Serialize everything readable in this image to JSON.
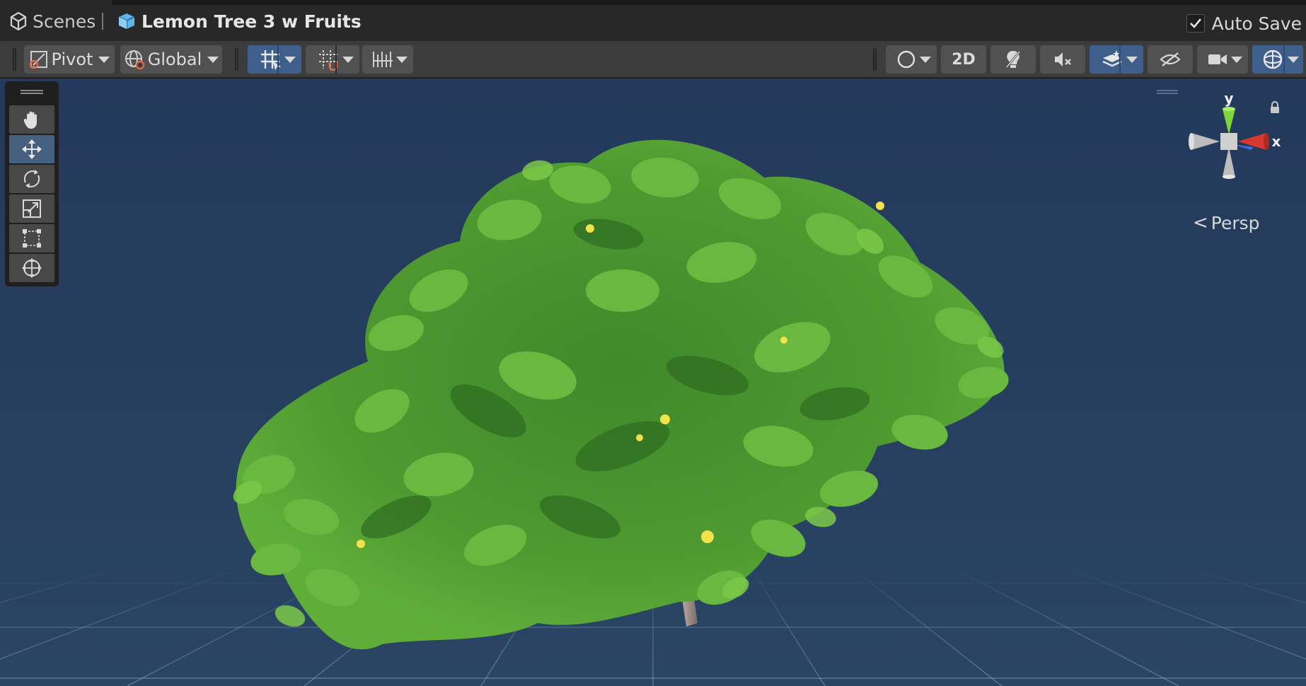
{
  "window": {
    "tab_label": "Scenes",
    "scene_name": "Lemon Tree 3 w Fruits",
    "auto_save": {
      "label": "Auto Save",
      "checked": true
    }
  },
  "toolbar": {
    "pivot_label": "Pivot",
    "global_label": "Global",
    "mode_2d_label": "2D",
    "left_buttons": [
      "grid-snap-toggle",
      "increment-snap",
      "snap-settings"
    ],
    "right_buttons": [
      "draw-mode",
      "2d-toggle",
      "lighting-toggle",
      "audio-toggle",
      "effects-toggle",
      "scene-visibility",
      "camera-settings",
      "gizmos-toggle"
    ]
  },
  "tools": [
    {
      "name": "hand-tool",
      "icon": "hand-icon",
      "active": false
    },
    {
      "name": "move-tool",
      "icon": "move-icon",
      "active": true
    },
    {
      "name": "rotate-tool",
      "icon": "rotate-icon",
      "active": false
    },
    {
      "name": "scale-tool",
      "icon": "scale-icon",
      "active": false
    },
    {
      "name": "rect-tool",
      "icon": "rect-icon",
      "active": false
    },
    {
      "name": "transform-tool",
      "icon": "transform-icon",
      "active": false
    }
  ],
  "gizmo": {
    "y_label": "y",
    "x_label": "x",
    "projection_label": "Persp"
  },
  "colors": {
    "accent": "#3e5e8c",
    "sky": "#24395b",
    "leaf": "#5aa83a",
    "leaf_dark": "#2f6b22",
    "fruit": "#f1e14a",
    "trunk": "#9a8c85"
  }
}
